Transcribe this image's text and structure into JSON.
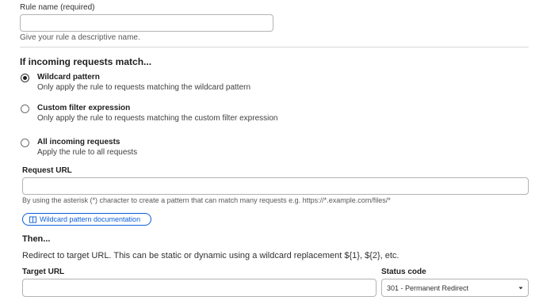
{
  "rule_name": {
    "label": "Rule name (required)",
    "value": "",
    "help": "Give your rule a descriptive name."
  },
  "match_section": {
    "title": "If incoming requests match...",
    "options": [
      {
        "title": "Wildcard pattern",
        "description": "Only apply the rule to requests matching the wildcard pattern",
        "checked": true
      },
      {
        "title": "Custom filter expression",
        "description": "Only apply the rule to requests matching the custom filter expression",
        "checked": false
      },
      {
        "title": "All incoming requests",
        "description": "Apply the rule to all requests",
        "checked": false
      }
    ]
  },
  "request_url": {
    "label": "Request URL",
    "value": "",
    "help": "By using the asterisk (*) character to create a pattern that can match many requests e.g. https://*.example.com/files/*"
  },
  "doc_button": {
    "label": "Wildcard pattern documentation",
    "icon": "book-icon",
    "color": "#0a5fd9"
  },
  "then_section": {
    "title": "Then...",
    "description": "Redirect to target URL. This can be static or dynamic using a wildcard replacement ${1}, ${2}, etc."
  },
  "target_url": {
    "label": "Target URL",
    "value": ""
  },
  "status_code": {
    "label": "Status code",
    "selected": "301 - Permanent Redirect"
  }
}
